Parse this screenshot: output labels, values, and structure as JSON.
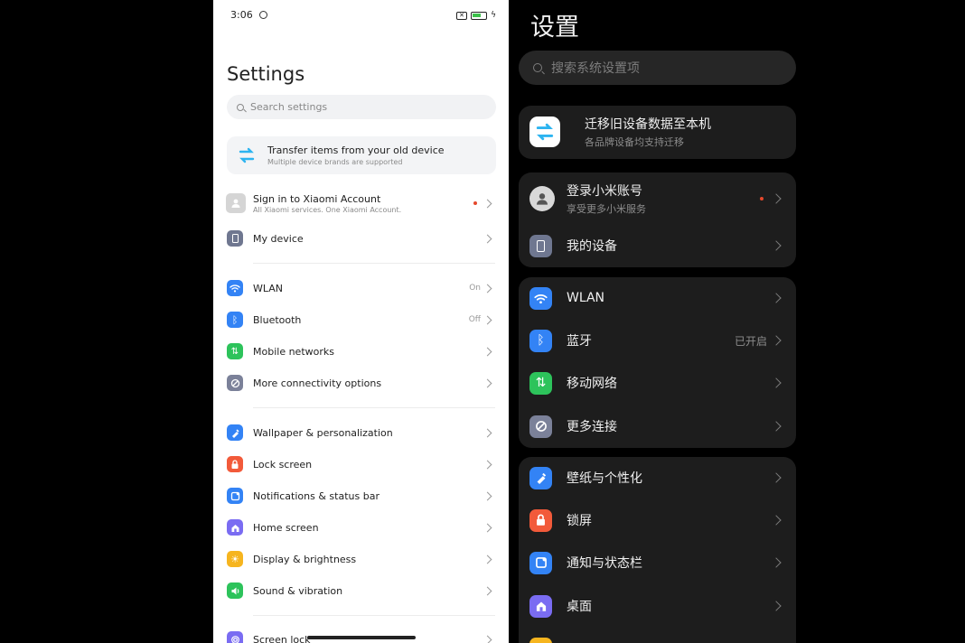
{
  "light": {
    "status": {
      "time": "3:06"
    },
    "title": "Settings",
    "search_placeholder": "Search settings",
    "transfer": {
      "title": "Transfer items from your old device",
      "subtitle": "Multiple device brands are supported"
    },
    "account": {
      "title": "Sign in to Xiaomi Account",
      "subtitle": "All Xiaomi services. One Xiaomi Account."
    },
    "items": [
      {
        "label": "My device",
        "icon": "phone-icon",
        "color": "#6f7790"
      },
      {
        "label": "WLAN",
        "value": "On",
        "icon": "wifi-icon",
        "color": "#3383f5"
      },
      {
        "label": "Bluetooth",
        "value": "Off",
        "icon": "bluetooth-icon",
        "color": "#3383f5"
      },
      {
        "label": "Mobile networks",
        "icon": "mobile-network-icon",
        "color": "#2dc35b"
      },
      {
        "label": "More connectivity options",
        "icon": "link-icon",
        "color": "#7b8199"
      },
      {
        "label": "Wallpaper & personalization",
        "icon": "brush-icon",
        "color": "#3383f5"
      },
      {
        "label": "Lock screen",
        "icon": "lock-icon",
        "color": "#f25a3a"
      },
      {
        "label": "Notifications & status bar",
        "icon": "notification-icon",
        "color": "#3383f5"
      },
      {
        "label": "Home screen",
        "icon": "home-icon",
        "color": "#7a6cf2"
      },
      {
        "label": "Display & brightness",
        "icon": "sun-icon",
        "color": "#f6b51f"
      },
      {
        "label": "Sound & vibration",
        "icon": "sound-icon",
        "color": "#2dc35b"
      },
      {
        "label": "Screen lock",
        "icon": "fingerprint-icon",
        "color": "#7a6cf2"
      }
    ]
  },
  "dark": {
    "title": "设置",
    "search_placeholder": "搜索系统设置项",
    "transfer": {
      "title": "迁移旧设备数据至本机",
      "subtitle": "各品牌设备均支持迁移"
    },
    "account": {
      "title": "登录小米账号",
      "subtitle": "享受更多小米服务"
    },
    "items": [
      {
        "label": "我的设备",
        "icon": "phone-icon",
        "color": "#6f7790"
      },
      {
        "label": "WLAN",
        "icon": "wifi-icon",
        "color": "#3383f5"
      },
      {
        "label": "蓝牙",
        "value": "已开启",
        "icon": "bluetooth-icon",
        "color": "#3383f5"
      },
      {
        "label": "移动网络",
        "icon": "mobile-network-icon",
        "color": "#2dc35b"
      },
      {
        "label": "更多连接",
        "icon": "link-icon",
        "color": "#7b8199"
      },
      {
        "label": "壁纸与个性化",
        "icon": "brush-icon",
        "color": "#3383f5"
      },
      {
        "label": "锁屏",
        "icon": "lock-icon",
        "color": "#f25a3a"
      },
      {
        "label": "通知与状态栏",
        "icon": "notification-icon",
        "color": "#3383f5"
      },
      {
        "label": "桌面",
        "icon": "home-icon",
        "color": "#7a6cf2"
      }
    ]
  }
}
